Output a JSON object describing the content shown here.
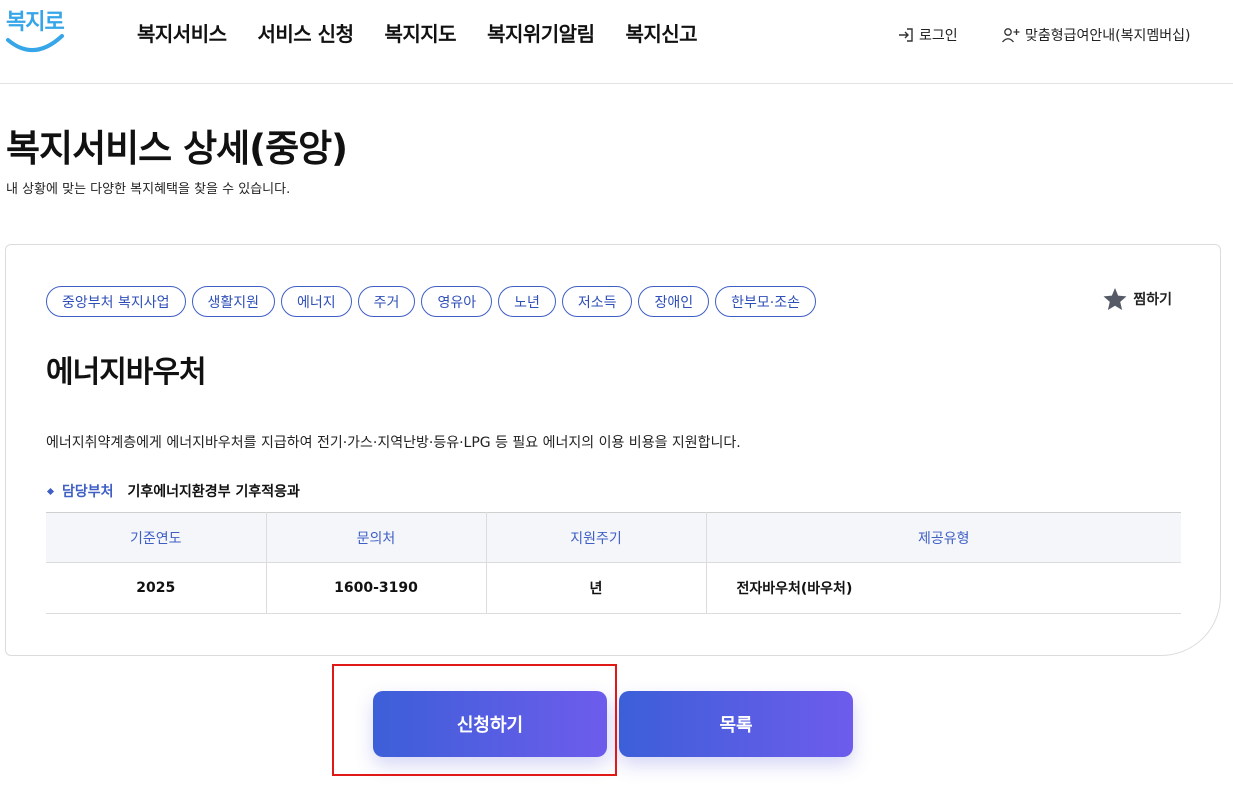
{
  "header": {
    "logo_text": "복지로",
    "nav": [
      "복지서비스",
      "서비스 신청",
      "복지지도",
      "복지위기알림",
      "복지신고"
    ],
    "login_label": "로그인",
    "member_label": "맞춤형급여안내(복지멤버십)"
  },
  "page": {
    "title": "복지서비스 상세(중앙)",
    "description": "내 상황에 맞는 다양한 복지혜택을 찾을 수 있습니다."
  },
  "service": {
    "tags": [
      "중앙부처 복지사업",
      "생활지원",
      "에너지",
      "주거",
      "영유아",
      "노년",
      "저소득",
      "장애인",
      "한부모·조손"
    ],
    "favorite_label": "찜하기",
    "title": "에너지바우처",
    "description": "에너지취약계층에게 에너지바우처를 지급하여 전기·가스·지역난방·등유·LPG 등 필요 에너지의 이용 비용을 지원합니다.",
    "dept_label": "담당부처",
    "dept_value": "기후에너지환경부 기후적응과",
    "table": {
      "headers": [
        "기준연도",
        "문의처",
        "지원주기",
        "제공유형"
      ],
      "row": [
        "2025",
        "1600-3190",
        "년",
        "전자바우처(바우처)"
      ]
    }
  },
  "actions": {
    "apply_label": "신청하기",
    "list_label": "목록"
  },
  "colors": {
    "accent": "#3f5fc5",
    "button_gradient_start": "#3c5fd8",
    "button_gradient_end": "#6e5cec",
    "highlight": "#e01818"
  }
}
